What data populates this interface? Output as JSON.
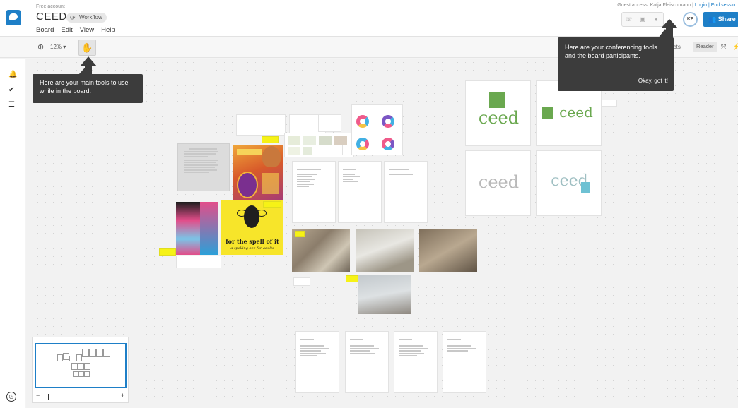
{
  "header": {
    "account_type": "Free account",
    "board_title": "CEED",
    "workflow_label": "Workflow",
    "menu": [
      "Board",
      "Edit",
      "View",
      "Help"
    ],
    "guest_access_prefix": "Guest access: Katja Fleischmann |",
    "login_label": "Login",
    "end_session_label": "| End sessio",
    "conference_icons": [
      "phone-icon",
      "video-icon",
      "chat-icon"
    ],
    "avatar_initials": "KF",
    "share_label": "Share"
  },
  "toolbar": {
    "zoom_level": "12%",
    "hand_icon": "✋",
    "objects_label": "bjects",
    "reader_label": "Reader"
  },
  "left_rail": {
    "icons": [
      "bell-icon",
      "check-circle-icon",
      "list-icon",
      "compass-icon"
    ]
  },
  "tooltips": {
    "main_tools": "Here are your main tools to use while in the board.",
    "conferencing": "Here are your conferencing tools and the board participants.",
    "ok_label": "Okay, got it!"
  },
  "canvas": {
    "poster_caption": "for the spell of it",
    "poster_subcaption": "a spelling bee for adults",
    "logo_texts": [
      "ceed",
      "ceed",
      "ceed",
      "ceed"
    ]
  },
  "colors": {
    "accent": "#1e7fc7",
    "tooltip_bg": "#3c3c3c",
    "sticky_yellow": "#f6f216",
    "logo_green": "#6aa84f"
  }
}
